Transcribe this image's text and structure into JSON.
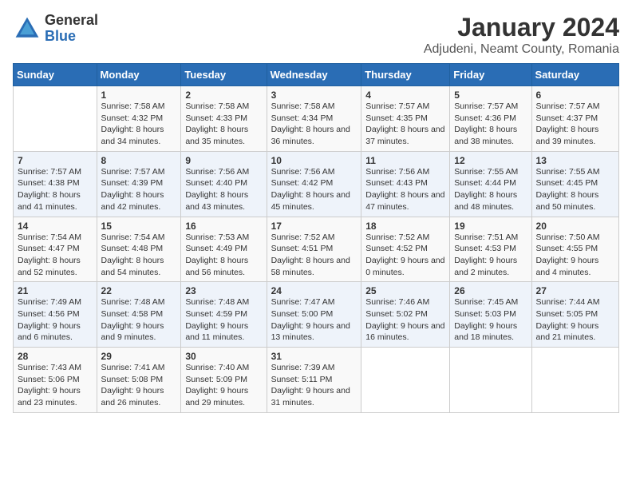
{
  "logo": {
    "general": "General",
    "blue": "Blue"
  },
  "title": "January 2024",
  "location": "Adjudeni, Neamt County, Romania",
  "weekdays": [
    "Sunday",
    "Monday",
    "Tuesday",
    "Wednesday",
    "Thursday",
    "Friday",
    "Saturday"
  ],
  "weeks": [
    [
      {
        "day": "",
        "sunrise": "",
        "sunset": "",
        "daylight": ""
      },
      {
        "day": "1",
        "sunrise": "Sunrise: 7:58 AM",
        "sunset": "Sunset: 4:32 PM",
        "daylight": "Daylight: 8 hours and 34 minutes."
      },
      {
        "day": "2",
        "sunrise": "Sunrise: 7:58 AM",
        "sunset": "Sunset: 4:33 PM",
        "daylight": "Daylight: 8 hours and 35 minutes."
      },
      {
        "day": "3",
        "sunrise": "Sunrise: 7:58 AM",
        "sunset": "Sunset: 4:34 PM",
        "daylight": "Daylight: 8 hours and 36 minutes."
      },
      {
        "day": "4",
        "sunrise": "Sunrise: 7:57 AM",
        "sunset": "Sunset: 4:35 PM",
        "daylight": "Daylight: 8 hours and 37 minutes."
      },
      {
        "day": "5",
        "sunrise": "Sunrise: 7:57 AM",
        "sunset": "Sunset: 4:36 PM",
        "daylight": "Daylight: 8 hours and 38 minutes."
      },
      {
        "day": "6",
        "sunrise": "Sunrise: 7:57 AM",
        "sunset": "Sunset: 4:37 PM",
        "daylight": "Daylight: 8 hours and 39 minutes."
      }
    ],
    [
      {
        "day": "7",
        "sunrise": "Sunrise: 7:57 AM",
        "sunset": "Sunset: 4:38 PM",
        "daylight": "Daylight: 8 hours and 41 minutes."
      },
      {
        "day": "8",
        "sunrise": "Sunrise: 7:57 AM",
        "sunset": "Sunset: 4:39 PM",
        "daylight": "Daylight: 8 hours and 42 minutes."
      },
      {
        "day": "9",
        "sunrise": "Sunrise: 7:56 AM",
        "sunset": "Sunset: 4:40 PM",
        "daylight": "Daylight: 8 hours and 43 minutes."
      },
      {
        "day": "10",
        "sunrise": "Sunrise: 7:56 AM",
        "sunset": "Sunset: 4:42 PM",
        "daylight": "Daylight: 8 hours and 45 minutes."
      },
      {
        "day": "11",
        "sunrise": "Sunrise: 7:56 AM",
        "sunset": "Sunset: 4:43 PM",
        "daylight": "Daylight: 8 hours and 47 minutes."
      },
      {
        "day": "12",
        "sunrise": "Sunrise: 7:55 AM",
        "sunset": "Sunset: 4:44 PM",
        "daylight": "Daylight: 8 hours and 48 minutes."
      },
      {
        "day": "13",
        "sunrise": "Sunrise: 7:55 AM",
        "sunset": "Sunset: 4:45 PM",
        "daylight": "Daylight: 8 hours and 50 minutes."
      }
    ],
    [
      {
        "day": "14",
        "sunrise": "Sunrise: 7:54 AM",
        "sunset": "Sunset: 4:47 PM",
        "daylight": "Daylight: 8 hours and 52 minutes."
      },
      {
        "day": "15",
        "sunrise": "Sunrise: 7:54 AM",
        "sunset": "Sunset: 4:48 PM",
        "daylight": "Daylight: 8 hours and 54 minutes."
      },
      {
        "day": "16",
        "sunrise": "Sunrise: 7:53 AM",
        "sunset": "Sunset: 4:49 PM",
        "daylight": "Daylight: 8 hours and 56 minutes."
      },
      {
        "day": "17",
        "sunrise": "Sunrise: 7:52 AM",
        "sunset": "Sunset: 4:51 PM",
        "daylight": "Daylight: 8 hours and 58 minutes."
      },
      {
        "day": "18",
        "sunrise": "Sunrise: 7:52 AM",
        "sunset": "Sunset: 4:52 PM",
        "daylight": "Daylight: 9 hours and 0 minutes."
      },
      {
        "day": "19",
        "sunrise": "Sunrise: 7:51 AM",
        "sunset": "Sunset: 4:53 PM",
        "daylight": "Daylight: 9 hours and 2 minutes."
      },
      {
        "day": "20",
        "sunrise": "Sunrise: 7:50 AM",
        "sunset": "Sunset: 4:55 PM",
        "daylight": "Daylight: 9 hours and 4 minutes."
      }
    ],
    [
      {
        "day": "21",
        "sunrise": "Sunrise: 7:49 AM",
        "sunset": "Sunset: 4:56 PM",
        "daylight": "Daylight: 9 hours and 6 minutes."
      },
      {
        "day": "22",
        "sunrise": "Sunrise: 7:48 AM",
        "sunset": "Sunset: 4:58 PM",
        "daylight": "Daylight: 9 hours and 9 minutes."
      },
      {
        "day": "23",
        "sunrise": "Sunrise: 7:48 AM",
        "sunset": "Sunset: 4:59 PM",
        "daylight": "Daylight: 9 hours and 11 minutes."
      },
      {
        "day": "24",
        "sunrise": "Sunrise: 7:47 AM",
        "sunset": "Sunset: 5:00 PM",
        "daylight": "Daylight: 9 hours and 13 minutes."
      },
      {
        "day": "25",
        "sunrise": "Sunrise: 7:46 AM",
        "sunset": "Sunset: 5:02 PM",
        "daylight": "Daylight: 9 hours and 16 minutes."
      },
      {
        "day": "26",
        "sunrise": "Sunrise: 7:45 AM",
        "sunset": "Sunset: 5:03 PM",
        "daylight": "Daylight: 9 hours and 18 minutes."
      },
      {
        "day": "27",
        "sunrise": "Sunrise: 7:44 AM",
        "sunset": "Sunset: 5:05 PM",
        "daylight": "Daylight: 9 hours and 21 minutes."
      }
    ],
    [
      {
        "day": "28",
        "sunrise": "Sunrise: 7:43 AM",
        "sunset": "Sunset: 5:06 PM",
        "daylight": "Daylight: 9 hours and 23 minutes."
      },
      {
        "day": "29",
        "sunrise": "Sunrise: 7:41 AM",
        "sunset": "Sunset: 5:08 PM",
        "daylight": "Daylight: 9 hours and 26 minutes."
      },
      {
        "day": "30",
        "sunrise": "Sunrise: 7:40 AM",
        "sunset": "Sunset: 5:09 PM",
        "daylight": "Daylight: 9 hours and 29 minutes."
      },
      {
        "day": "31",
        "sunrise": "Sunrise: 7:39 AM",
        "sunset": "Sunset: 5:11 PM",
        "daylight": "Daylight: 9 hours and 31 minutes."
      },
      {
        "day": "",
        "sunrise": "",
        "sunset": "",
        "daylight": ""
      },
      {
        "day": "",
        "sunrise": "",
        "sunset": "",
        "daylight": ""
      },
      {
        "day": "",
        "sunrise": "",
        "sunset": "",
        "daylight": ""
      }
    ]
  ]
}
